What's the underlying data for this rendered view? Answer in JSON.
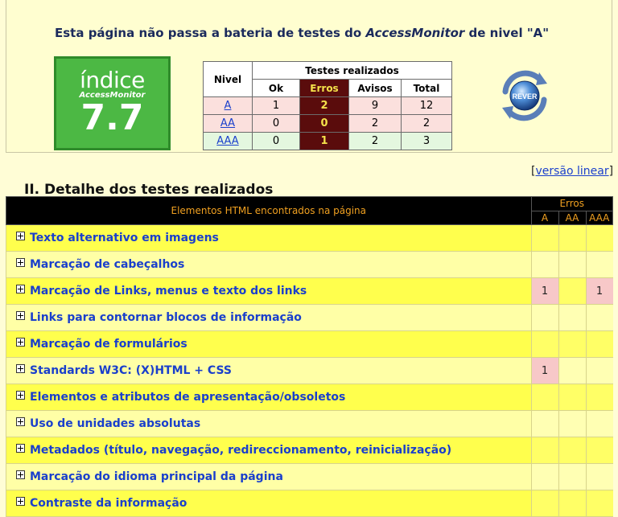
{
  "verdict": {
    "prefix": "Esta página não passa a bateria de testes do ",
    "brand": "AccessMonitor",
    "suffix": " de nivel \"A\""
  },
  "score": {
    "label": "índice",
    "brand": "AccessMonitor",
    "value": "7.7"
  },
  "tests_table": {
    "title": "Testes realizados",
    "nivel_header": "Nivel",
    "columns": [
      "Ok",
      "Erros",
      "Avisos",
      "Total"
    ],
    "rows": [
      {
        "level": "A",
        "ok": "1",
        "erros": "2",
        "avisos": "9",
        "total": "12"
      },
      {
        "level": "AA",
        "ok": "0",
        "erros": "0",
        "avisos": "2",
        "total": "2"
      },
      {
        "level": "AAA",
        "ok": "0",
        "erros": "1",
        "avisos": "2",
        "total": "3"
      }
    ]
  },
  "rever_button": {
    "label": "REVER"
  },
  "linear_link": {
    "open": "[",
    "label": "versão linear",
    "close": "]"
  },
  "section_title": "II. Detalhe dos testes realizados",
  "detail_table": {
    "header_main": "Elementos HTML encontrados na página",
    "header_erros": "Erros",
    "levels": [
      "A",
      "AA",
      "AAA"
    ],
    "rows": [
      {
        "name": "Texto alternativo em imagens",
        "a": "",
        "aa": "",
        "aaa": ""
      },
      {
        "name": "Marcação de cabeçalhos",
        "a": "",
        "aa": "",
        "aaa": ""
      },
      {
        "name": "Marcação de Links, menus e texto dos links",
        "a": "1",
        "aa": "",
        "aaa": "1"
      },
      {
        "name": "Links para contornar blocos de informação",
        "a": "",
        "aa": "",
        "aaa": ""
      },
      {
        "name": "Marcação de formulários",
        "a": "",
        "aa": "",
        "aaa": ""
      },
      {
        "name": "Standards W3C: (X)HTML + CSS",
        "a": "1",
        "aa": "",
        "aaa": ""
      },
      {
        "name": "Elementos e atributos de apresentação/obsoletos",
        "a": "",
        "aa": "",
        "aaa": ""
      },
      {
        "name": "Uso de unidades absolutas",
        "a": "",
        "aa": "",
        "aaa": ""
      },
      {
        "name": "Metadados (título, navegação, redireccionamento, reinicialização)",
        "a": "",
        "aa": "",
        "aaa": ""
      },
      {
        "name": "Marcação do idioma principal da página",
        "a": "",
        "aa": "",
        "aaa": ""
      },
      {
        "name": "Contraste da informação",
        "a": "",
        "aa": "",
        "aaa": ""
      }
    ]
  },
  "colors": {
    "page_bg": "#fffdd6",
    "score_bg": "#4cb844",
    "errors_bg": "#5a0c0c",
    "errors_text": "#f5e24a",
    "row_yellow": "#ffff4d",
    "link_blue": "#1a3fcc",
    "hit_pink": "#f7c8c8"
  },
  "icons": {
    "expand": "plus-square-icon",
    "rever": "refresh-globe-icon"
  }
}
